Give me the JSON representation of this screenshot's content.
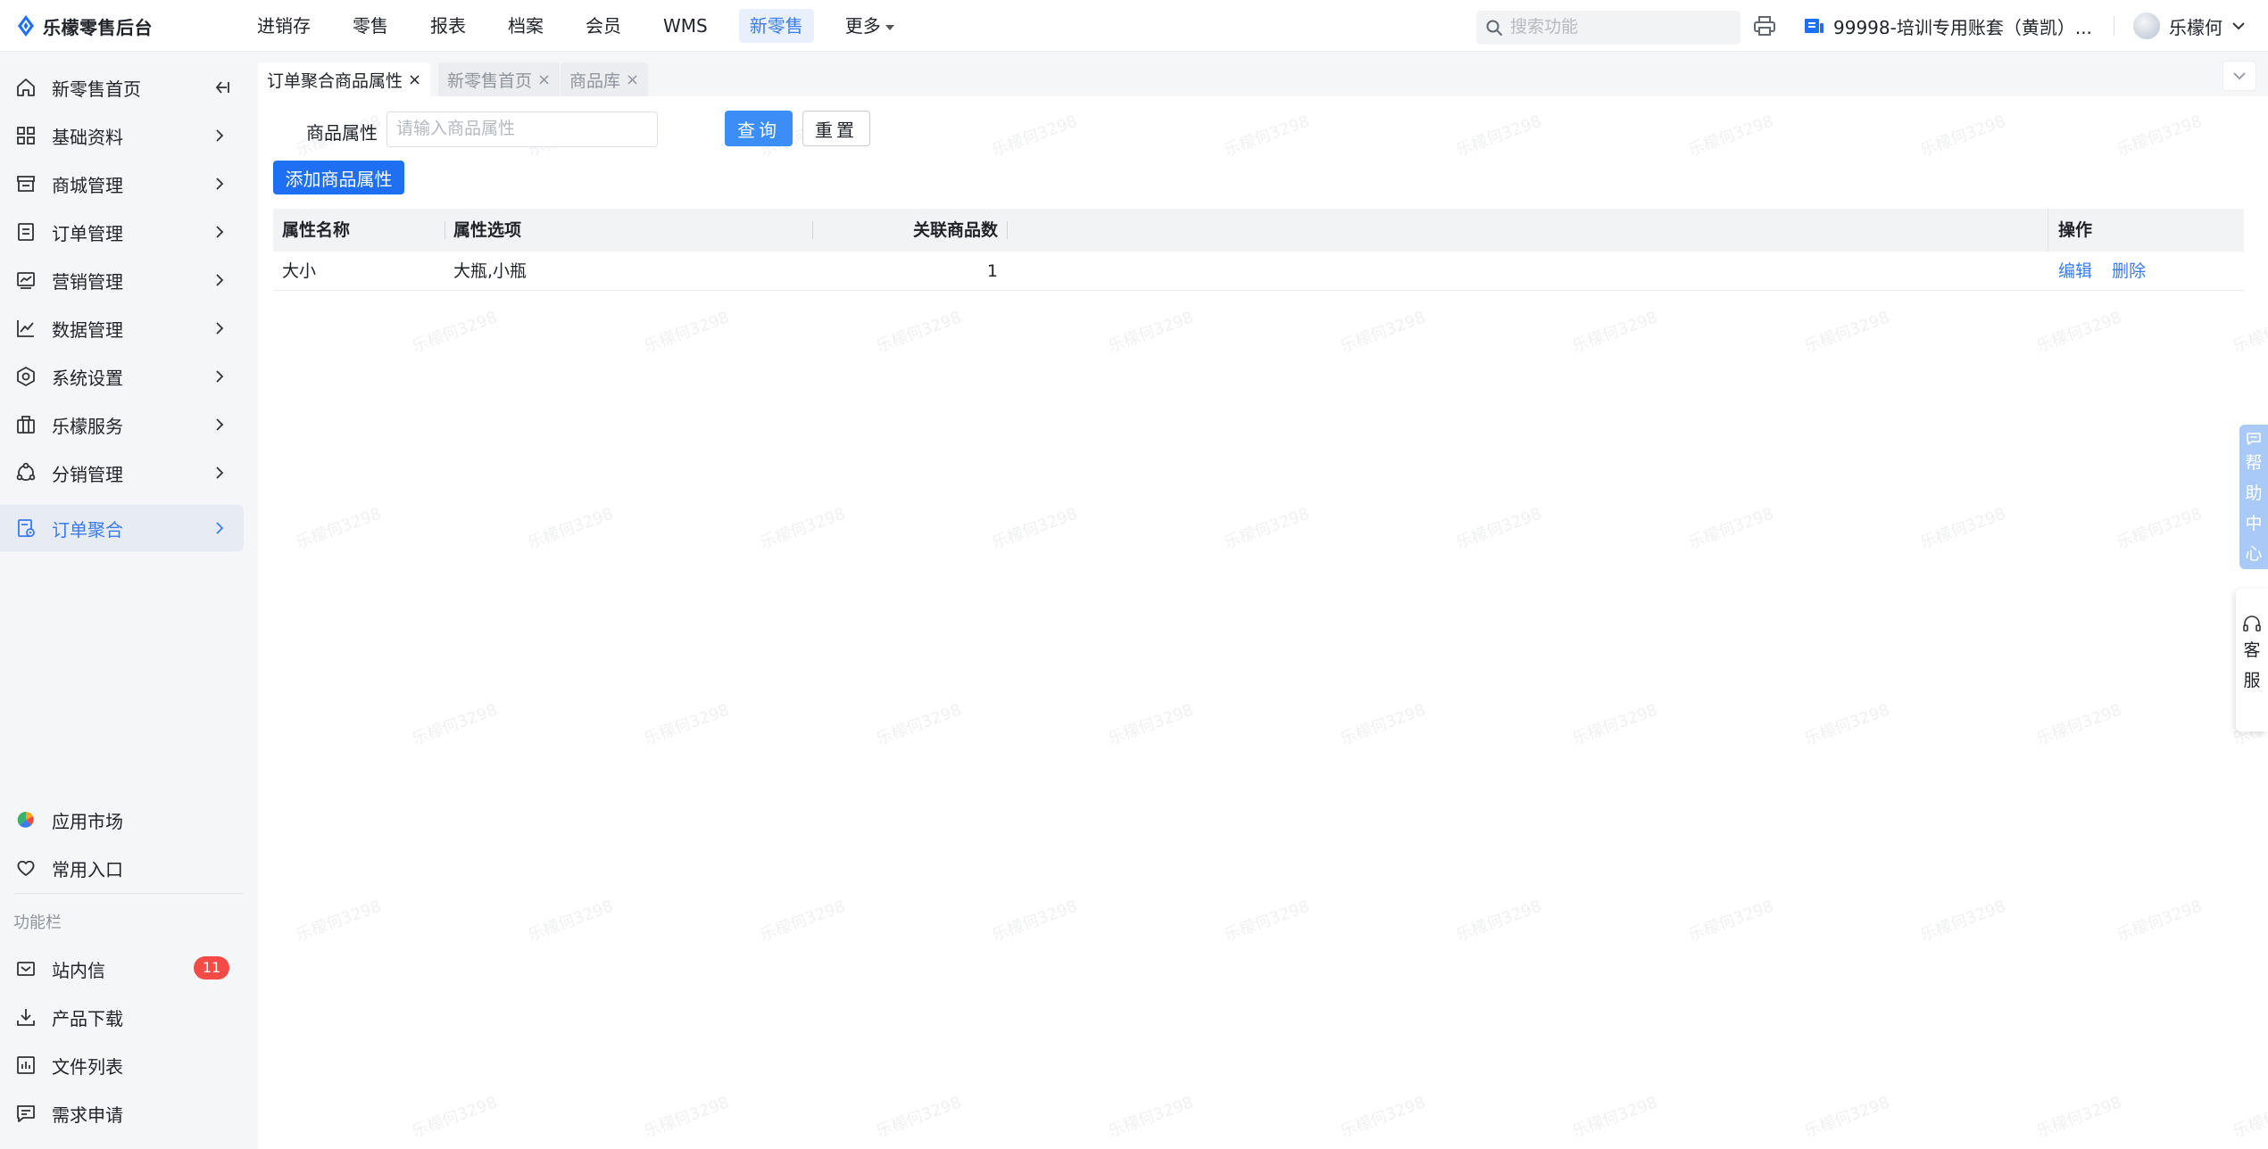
{
  "app": {
    "logo_text": "乐檬零售后台",
    "brand_color": "#3a7bf0"
  },
  "topnav": {
    "items": [
      "进销存",
      "零售",
      "报表",
      "档案",
      "会员",
      "WMS",
      "新零售",
      "更多"
    ],
    "active": "新零售",
    "search_placeholder": "搜索功能",
    "account": "99998-培训专用账套（黄凯）...",
    "user": "乐檬何"
  },
  "sidebar": {
    "items": [
      {
        "label": "新零售首页",
        "icon": "home-icon"
      },
      {
        "label": "基础资料",
        "icon": "grid-icon"
      },
      {
        "label": "商城管理",
        "icon": "store-icon"
      },
      {
        "label": "订单管理",
        "icon": "order-icon"
      },
      {
        "label": "营销管理",
        "icon": "marketing-icon"
      },
      {
        "label": "数据管理",
        "icon": "chart-icon"
      },
      {
        "label": "系统设置",
        "icon": "settings-icon"
      },
      {
        "label": "乐檬服务",
        "icon": "briefcase-icon"
      },
      {
        "label": "分销管理",
        "icon": "share-icon"
      },
      {
        "label": "订单聚合",
        "icon": "order-aggregate-icon"
      }
    ],
    "active": "订单聚合",
    "bottom_items": [
      {
        "label": "应用市场",
        "icon": "app-market-icon"
      },
      {
        "label": "常用入口",
        "icon": "heart-icon"
      }
    ],
    "group_title": "功能栏",
    "function_items": [
      {
        "label": "站内信",
        "icon": "mail-icon",
        "badge": "11"
      },
      {
        "label": "产品下载",
        "icon": "download-icon"
      },
      {
        "label": "文件列表",
        "icon": "file-list-icon"
      },
      {
        "label": "需求申请",
        "icon": "request-icon"
      }
    ]
  },
  "tabs": [
    {
      "label": "订单聚合商品属性",
      "close": "×",
      "active": true
    },
    {
      "label": "新零售首页",
      "close": "×",
      "active": false
    },
    {
      "label": "商品库",
      "close": "×",
      "active": false
    }
  ],
  "filter": {
    "label": "商品属性",
    "placeholder": "请输入商品属性",
    "value": "",
    "query_button": "查询",
    "reset_button": "重置"
  },
  "add_button": "添加商品属性",
  "table": {
    "headers": [
      "属性名称",
      "属性选项",
      "关联商品数",
      "操作"
    ],
    "rows": [
      {
        "name": "大小",
        "options": "大瓶,小瓶",
        "count": "1",
        "actions": [
          "编辑",
          "删除"
        ]
      }
    ]
  },
  "watermark": "乐檬何3298",
  "float": {
    "help": [
      "帮",
      "助",
      "中",
      "心"
    ],
    "service": [
      "客",
      "服"
    ]
  }
}
